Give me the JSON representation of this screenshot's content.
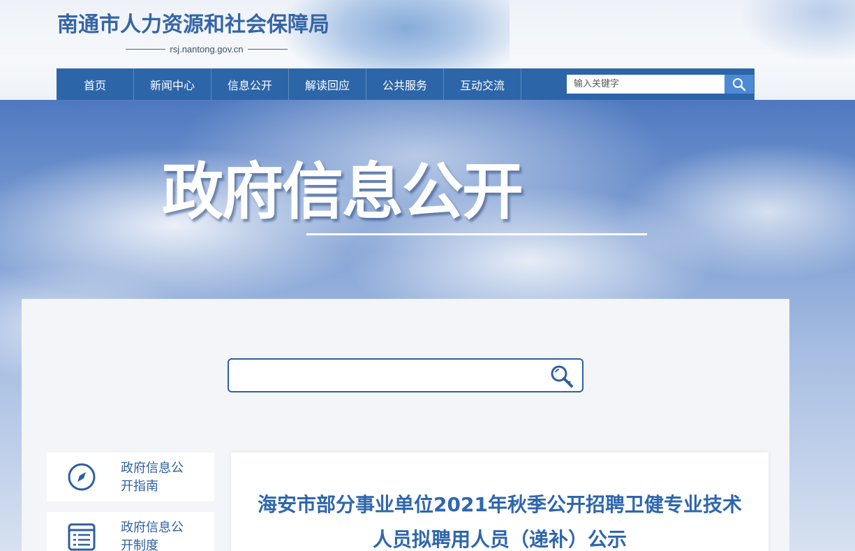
{
  "header": {
    "title": "南通市人力资源和社会保障局",
    "url": "rsj.nantong.gov.cn"
  },
  "nav": {
    "items": [
      "首页",
      "新闻中心",
      "信息公开",
      "解读回应",
      "公共服务",
      "互动交流"
    ],
    "search_placeholder": "输入关键字",
    "search_icon": "magnifier-icon"
  },
  "banner": {
    "title": "政府信息公开"
  },
  "panel": {
    "search_placeholder": "",
    "search_icon": "magnifier-key-icon",
    "sidebar": [
      {
        "label": "政府信息公开指南",
        "icon": "compass-icon"
      },
      {
        "label": "政府信息公开制度",
        "icon": "document-list-icon"
      }
    ]
  },
  "article": {
    "title": "海安市部分事业单位2021年秋季公开招聘卫健专业技术人员拟聘用人员（递补）公示"
  },
  "colors": {
    "brand": "#2c65a8",
    "title_blue": "#2e66ad",
    "search_btn": "#4d8ad6"
  }
}
